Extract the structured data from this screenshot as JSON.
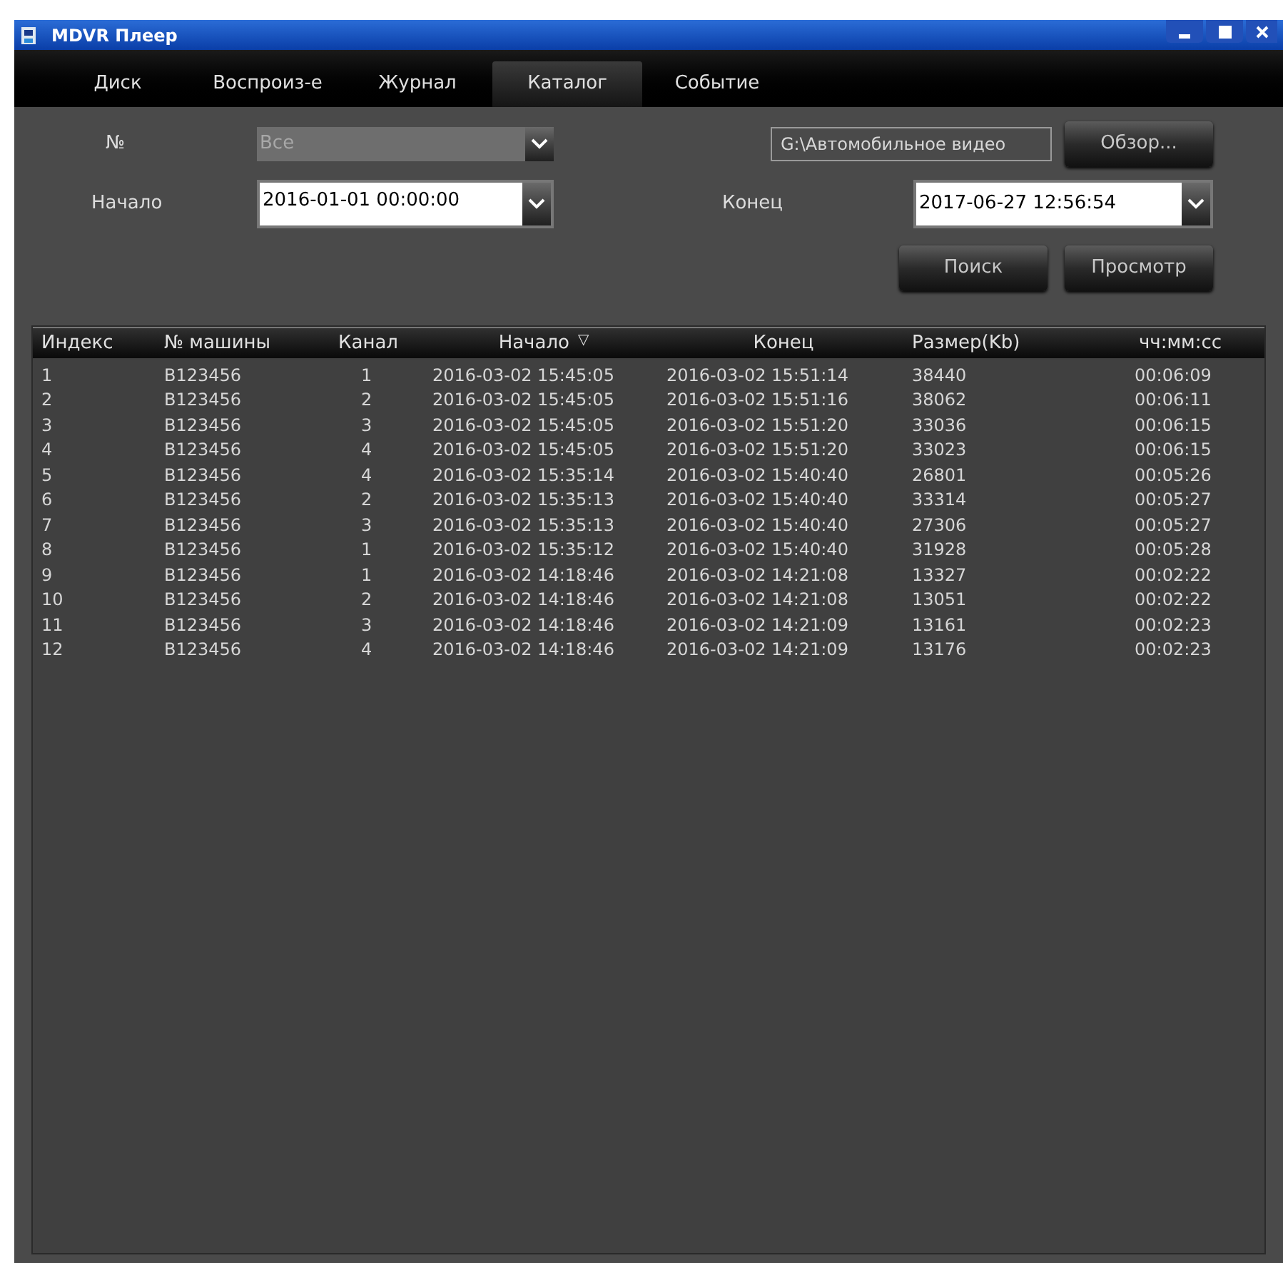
{
  "window": {
    "title": "MDVR Плеер"
  },
  "tabs": [
    {
      "label": "Диск",
      "selected": false
    },
    {
      "label": "Воспроиз-е",
      "selected": false
    },
    {
      "label": "Журнал",
      "selected": false
    },
    {
      "label": "Каталог",
      "selected": true
    },
    {
      "label": "Событие",
      "selected": false
    }
  ],
  "filters": {
    "number": {
      "label": "№",
      "value": "Все",
      "disabled": true
    },
    "path": {
      "value": "G:\\Автомобильное видео"
    },
    "browse_button": "Обзор...",
    "start": {
      "label": "Начало",
      "value": "2016-01-01 00:00:00"
    },
    "end": {
      "label": "Конец",
      "value": "2017-06-27 12:56:54"
    },
    "search_button": "Поиск",
    "view_button": "Просмотр"
  },
  "table": {
    "columns": [
      {
        "label": "Индекс"
      },
      {
        "label": "№ машины"
      },
      {
        "label": "Канал"
      },
      {
        "label": "Начало",
        "sort_mark": "▽"
      },
      {
        "label": "Конец"
      },
      {
        "label": "Размер(Kb)"
      },
      {
        "label": "чч:мм:сс"
      }
    ],
    "rows": [
      [
        "1",
        "B123456",
        "1",
        "2016-03-02 15:45:05",
        "2016-03-02 15:51:14",
        "38440",
        "00:06:09"
      ],
      [
        "2",
        "B123456",
        "2",
        "2016-03-02 15:45:05",
        "2016-03-02 15:51:16",
        "38062",
        "00:06:11"
      ],
      [
        "3",
        "B123456",
        "3",
        "2016-03-02 15:45:05",
        "2016-03-02 15:51:20",
        "33036",
        "00:06:15"
      ],
      [
        "4",
        "B123456",
        "4",
        "2016-03-02 15:45:05",
        "2016-03-02 15:51:20",
        "33023",
        "00:06:15"
      ],
      [
        "5",
        "B123456",
        "4",
        "2016-03-02 15:35:14",
        "2016-03-02 15:40:40",
        "26801",
        "00:05:26"
      ],
      [
        "6",
        "B123456",
        "2",
        "2016-03-02 15:35:13",
        "2016-03-02 15:40:40",
        "33314",
        "00:05:27"
      ],
      [
        "7",
        "B123456",
        "3",
        "2016-03-02 15:35:13",
        "2016-03-02 15:40:40",
        "27306",
        "00:05:27"
      ],
      [
        "8",
        "B123456",
        "1",
        "2016-03-02 15:35:12",
        "2016-03-02 15:40:40",
        "31928",
        "00:05:28"
      ],
      [
        "9",
        "B123456",
        "1",
        "2016-03-02 14:18:46",
        "2016-03-02 14:21:08",
        "13327",
        "00:02:22"
      ],
      [
        "10",
        "B123456",
        "2",
        "2016-03-02 14:18:46",
        "2016-03-02 14:21:08",
        "13051",
        "00:02:22"
      ],
      [
        "11",
        "B123456",
        "3",
        "2016-03-02 14:18:46",
        "2016-03-02 14:21:09",
        "13161",
        "00:02:23"
      ],
      [
        "12",
        "B123456",
        "4",
        "2016-03-02 14:18:46",
        "2016-03-02 14:21:09",
        "13176",
        "00:02:23"
      ]
    ]
  }
}
